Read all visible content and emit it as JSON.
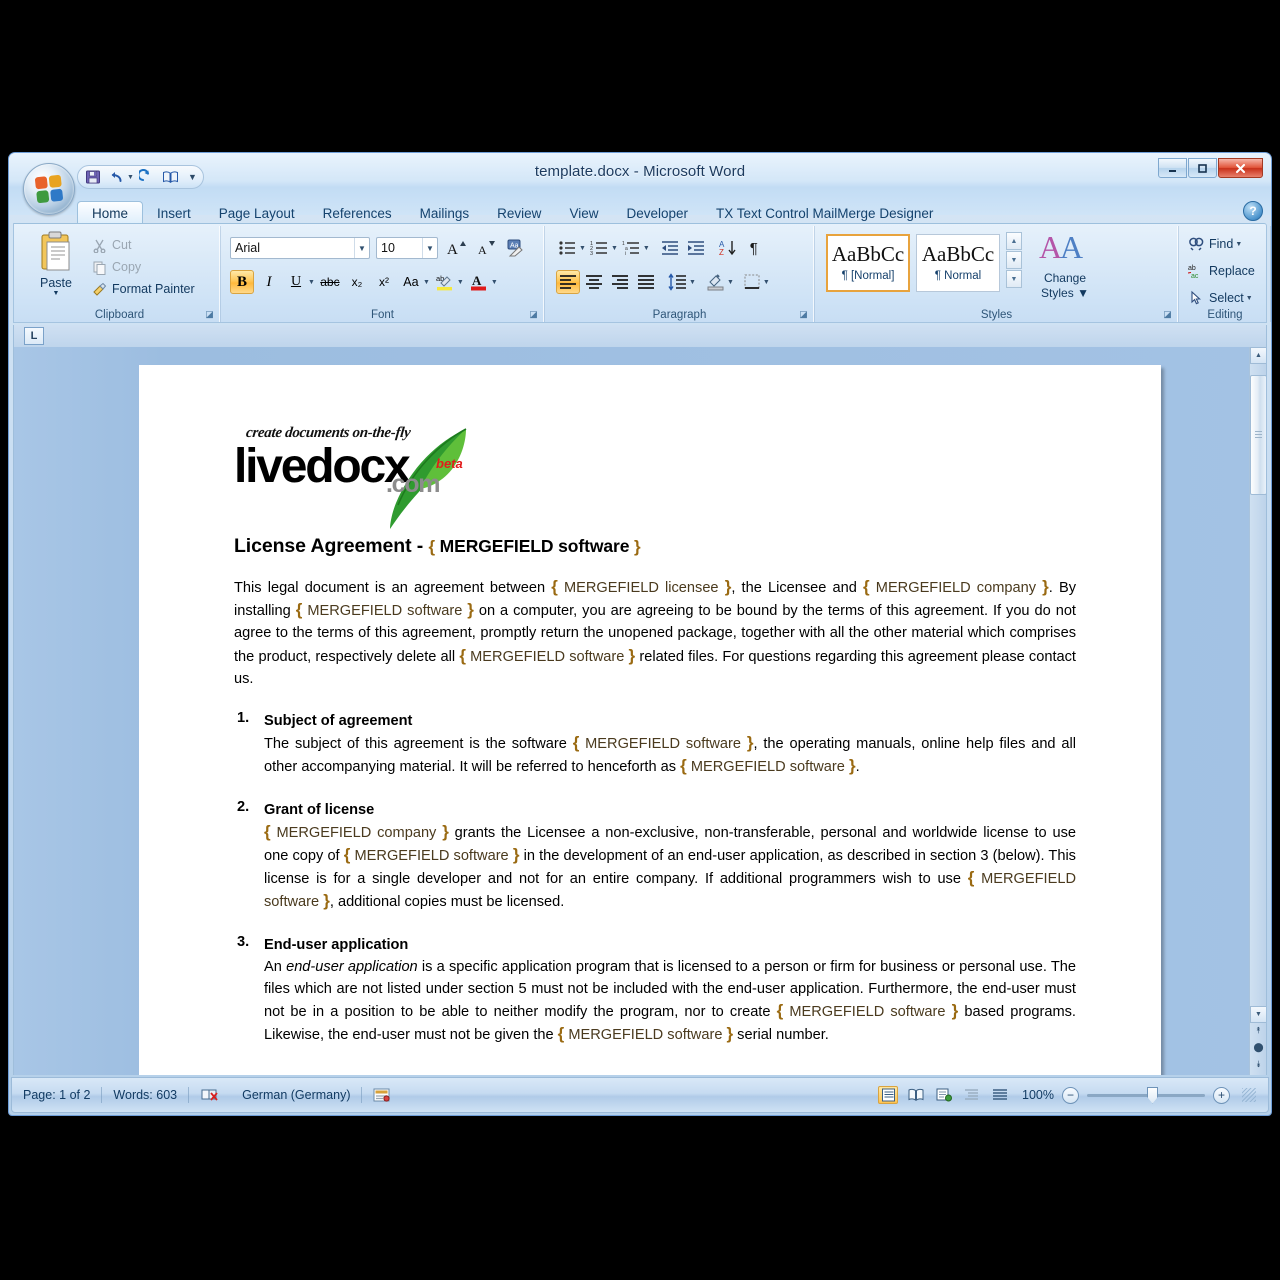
{
  "window": {
    "title": "template.docx - Microsoft Word",
    "minimize_label": "—",
    "maximize_label": "❐",
    "close_label": "✕"
  },
  "office_button": {
    "name": "Office Button",
    "colors": [
      "#e8622a",
      "#e8a320",
      "#3f9a3f",
      "#2f79c7"
    ]
  },
  "quick_access": [
    {
      "name": "save-icon",
      "label": "Save"
    },
    {
      "name": "undo-icon",
      "label": "Undo"
    },
    {
      "name": "redo-icon",
      "label": "Redo"
    },
    {
      "name": "print-preview-icon",
      "label": "Print Preview"
    },
    {
      "name": "customize-qat-icon",
      "label": "Customize Quick Access Toolbar"
    }
  ],
  "tabs": [
    {
      "label": "Home",
      "active": true
    },
    {
      "label": "Insert",
      "active": false
    },
    {
      "label": "Page Layout",
      "active": false
    },
    {
      "label": "References",
      "active": false
    },
    {
      "label": "Mailings",
      "active": false
    },
    {
      "label": "Review",
      "active": false
    },
    {
      "label": "View",
      "active": false
    },
    {
      "label": "Developer",
      "active": false
    },
    {
      "label": "TX Text Control MailMerge Designer",
      "active": false
    }
  ],
  "help_label": "?",
  "ribbon": {
    "clipboard": {
      "group_label": "Clipboard",
      "paste_label": "Paste",
      "cut_label": "Cut",
      "copy_label": "Copy",
      "format_painter_label": "Format Painter"
    },
    "font": {
      "group_label": "Font",
      "font_name": "Arial",
      "font_size": "10",
      "grow_font_label": "A",
      "shrink_font_label": "A",
      "clear_formatting_label": "Aa",
      "bold_label": "B",
      "italic_label": "I",
      "underline_label": "U",
      "strikethrough_label": "abc",
      "subscript_label": "x₂",
      "superscript_label": "x²",
      "change_case_label": "Aa",
      "highlight_label": "ab",
      "font_color_label": "A",
      "bold_active": true
    },
    "paragraph": {
      "group_label": "Paragraph",
      "bullets_label": "•",
      "numbering_label": "1.",
      "multilevel_label": "a.",
      "decrease_indent_label": "⮜",
      "increase_indent_label": "⮞",
      "sort_label": "A↓",
      "show_marks_label": "¶",
      "align_left_label": "≡",
      "align_center_label": "≡",
      "align_right_label": "≡",
      "justify_label": "≡",
      "line_spacing_label": "↕",
      "shading_label": "◧",
      "borders_label": "▦",
      "align_left_active": true
    },
    "styles": {
      "group_label": "Styles",
      "gallery": [
        {
          "preview": "AaBbCc",
          "name": "¶ [Normal]",
          "selected": true
        },
        {
          "preview": "AaBbCc",
          "name": "¶ Normal",
          "selected": false
        }
      ],
      "change_styles_label": "Change\nStyles",
      "change_styles_line1": "Change",
      "change_styles_line2": "Styles"
    },
    "editing": {
      "group_label": "Editing",
      "find_label": "Find",
      "replace_label": "Replace",
      "select_label": "Select"
    }
  },
  "ruler": {
    "tab_selector_label": "L"
  },
  "document": {
    "logo": {
      "tagline": "create documents on-the-fly",
      "wordmark": "livedocx",
      "domain": ".com",
      "badge": "beta"
    },
    "title_prefix": "License Agreement - ",
    "title_field": "MERGEFIELD software",
    "intro": [
      {
        "t": "This legal document is an agreement between "
      },
      {
        "f": "MERGEFIELD licensee"
      },
      {
        "t": ", the Licensee and "
      },
      {
        "f": "MERGEFIELD company"
      },
      {
        "t": ". By installing "
      },
      {
        "f": "MERGEFIELD software"
      },
      {
        "t": " on a computer, you are agreeing to be bound by the terms of this agreement. If you do not agree to the terms of this agreement, promptly return the unopened package, together with all the other material which comprises the product, respectively delete all "
      },
      {
        "f": "MERGEFIELD software"
      },
      {
        "t": " related files. For questions regarding this agreement please contact us."
      }
    ],
    "sections": [
      {
        "num": "1.",
        "heading": "Subject of agreement",
        "body": [
          {
            "t": "The subject of this agreement is the software "
          },
          {
            "f": "MERGEFIELD software"
          },
          {
            "t": ", the operating manuals, online help files and all other accompanying material. It will be referred to henceforth as "
          },
          {
            "f": "MERGEFIELD software"
          },
          {
            "t": "."
          }
        ]
      },
      {
        "num": "2.",
        "heading": "Grant of license",
        "body": [
          {
            "f": "MERGEFIELD company"
          },
          {
            "t": " grants the Licensee a non-exclusive, non-transferable, personal and worldwide license to use one copy of "
          },
          {
            "f": "MERGEFIELD software"
          },
          {
            "t": " in the development of an end-user application, as described in section 3 (below). This license is for a single developer and not for an entire company. If additional programmers wish to use "
          },
          {
            "f": "MERGEFIELD software"
          },
          {
            "t": ", additional copies must be licensed."
          }
        ]
      },
      {
        "num": "3.",
        "heading": "End-user application",
        "body": [
          {
            "t": "An "
          },
          {
            "i": "end-user application"
          },
          {
            "t": " is a specific application program that is licensed to a person or firm for business or personal use. The files which are not listed under section 5 must not be included with the end-user application. Furthermore, the end-user must not be in a position to be able to neither modify the program, nor to create "
          },
          {
            "f": "MERGEFIELD software"
          },
          {
            "t": " based programs. Likewise, the end-user must not be given the "
          },
          {
            "f": "MERGEFIELD software"
          },
          {
            "t": " serial number."
          }
        ]
      }
    ]
  },
  "status_bar": {
    "page_label": "Page: 1 of 2",
    "words_label": "Words: 603",
    "proofing_icon": "spelling-errors-icon",
    "language_label": "German (Germany)",
    "macro_icon": "record-macro-icon",
    "views": [
      {
        "name": "print-layout-view",
        "label": "☰",
        "active": true
      },
      {
        "name": "full-screen-reading-view",
        "label": "📖",
        "active": false
      },
      {
        "name": "web-layout-view",
        "label": "⬜",
        "active": false
      },
      {
        "name": "outline-view",
        "label": "≣",
        "active": false
      },
      {
        "name": "draft-view",
        "label": "≡",
        "active": false
      }
    ],
    "zoom_percent": "100%",
    "zoom_out_label": "−",
    "zoom_in_label": "+"
  }
}
